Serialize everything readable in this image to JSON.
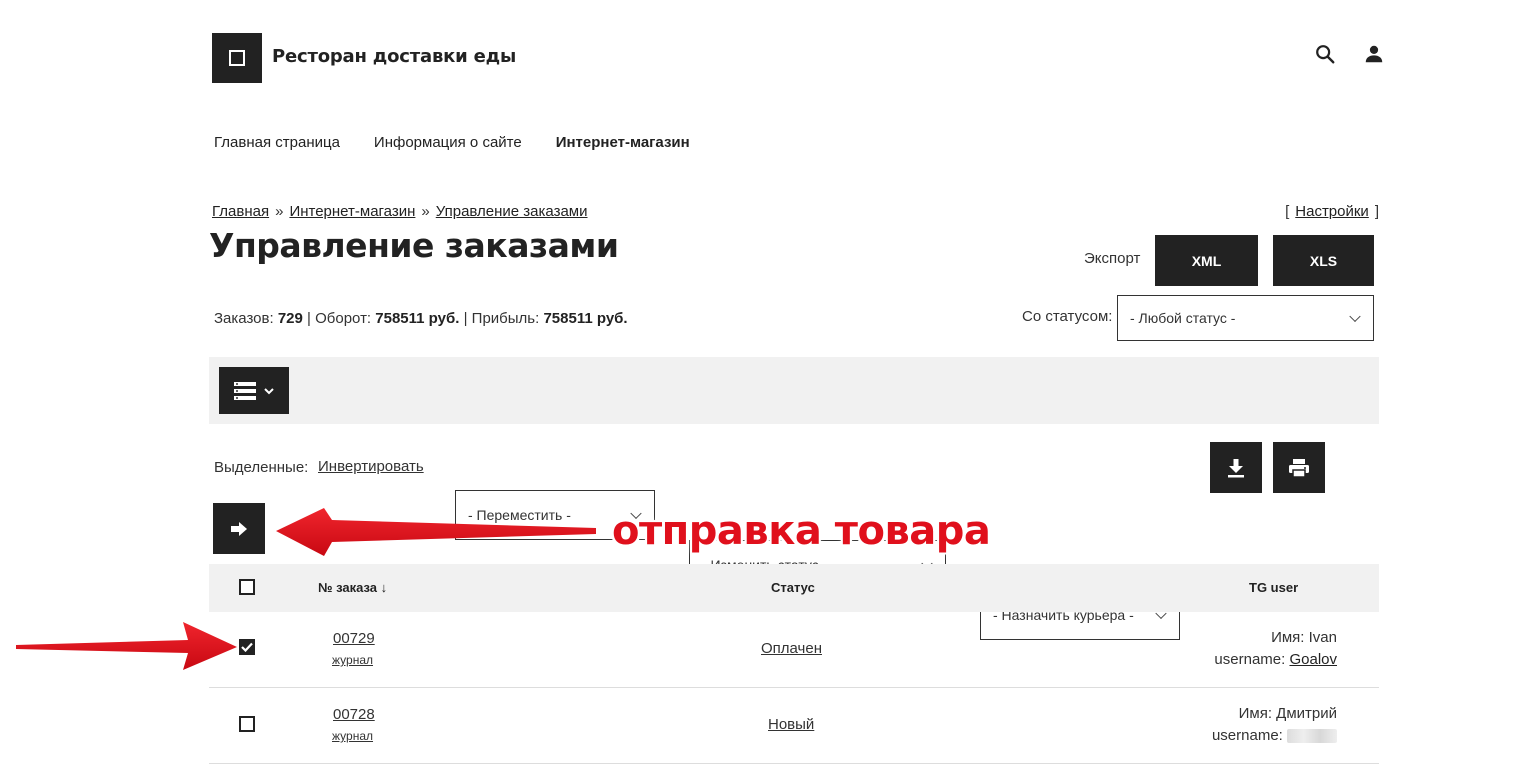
{
  "header": {
    "site_title": "Ресторан доставки еды",
    "icons": [
      "search-icon",
      "user-icon"
    ]
  },
  "nav": [
    {
      "label": "Главная страница",
      "active": false
    },
    {
      "label": "Информация о сайте",
      "active": false
    },
    {
      "label": "Интернет-магазин",
      "active": true
    }
  ],
  "breadcrumb": {
    "items": [
      "Главная",
      "Интернет-магазин",
      "Управление заказами"
    ],
    "separator": "»"
  },
  "settings": {
    "open": "[",
    "label": "Настройки",
    "close": "]"
  },
  "page": {
    "title": "Управление заказами"
  },
  "export": {
    "label": "Экспорт",
    "xml": "XML",
    "xls": "XLS"
  },
  "stats": {
    "orders_label": "Заказов:",
    "orders_value": "729",
    "turnover_label": "Оборот:",
    "turnover_value": "758511 руб.",
    "profit_label": "Прибыль:",
    "profit_value": "758511 руб.",
    "divider": "|"
  },
  "status_filter": {
    "label": "Со статусом:",
    "value": "- Любой статус -"
  },
  "bulk": {
    "selected_label": "Выделенные:",
    "invert": "Инвертировать",
    "move": "- Переместить -",
    "change_status": "- Изменить статус -",
    "assign_courier": "- Назначить курьера -"
  },
  "annotation": {
    "text": "отправка товара",
    "color": "#e0101c"
  },
  "table": {
    "headers": {
      "order": "№ заказа ↓",
      "status": "Статус",
      "tg": "TG user"
    },
    "rows": [
      {
        "order": "00729",
        "journal": "журнал",
        "status": "Оплачен",
        "name_label": "Имя:",
        "name": "Ivan",
        "username_label": "username:",
        "username": "Goalov",
        "checked": true
      },
      {
        "order": "00728",
        "journal": "журнал",
        "status": "Новый",
        "name_label": "Имя:",
        "name": "Дмитрий",
        "username_label": "username:",
        "username": "",
        "checked": false
      }
    ]
  },
  "colors": {
    "dark": "#222222",
    "strip": "#f1f1f1",
    "accent": "#e0101c"
  }
}
